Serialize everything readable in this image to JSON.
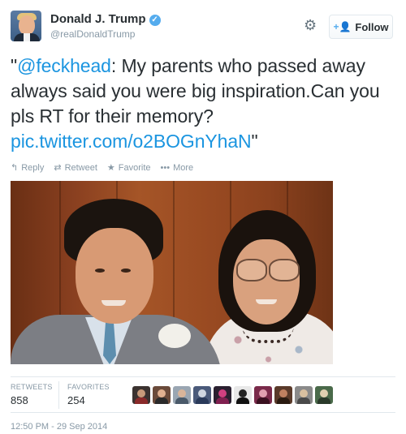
{
  "user": {
    "display_name": "Donald J. Trump",
    "screen_name": "@realDonaldTrump",
    "verified": true
  },
  "header": {
    "follow_label": "Follow",
    "icons": [
      "gear-icon",
      "add-user-icon",
      "verified-icon"
    ]
  },
  "tweet": {
    "text_before": "\"",
    "mention": "@feckhead",
    "text_body": ":  My parents who passed away always said you were big inspiration.Can you pls RT for their memory?",
    "link": "pic.twitter.com/o2BOGnYhaN",
    "text_after": "\""
  },
  "actions": {
    "reply": "Reply",
    "retweet": "Retweet",
    "favorite": "Favorite",
    "more": "More"
  },
  "stats": {
    "retweets_label": "RETWEETS",
    "retweets_value": "858",
    "favorites_label": "FAVORITES",
    "favorites_value": "254"
  },
  "timestamp": "12:50 PM - 29 Sep 2014",
  "colors": {
    "link": "#1b95e0",
    "verified": "#55acee",
    "muted": "#8899a6"
  }
}
